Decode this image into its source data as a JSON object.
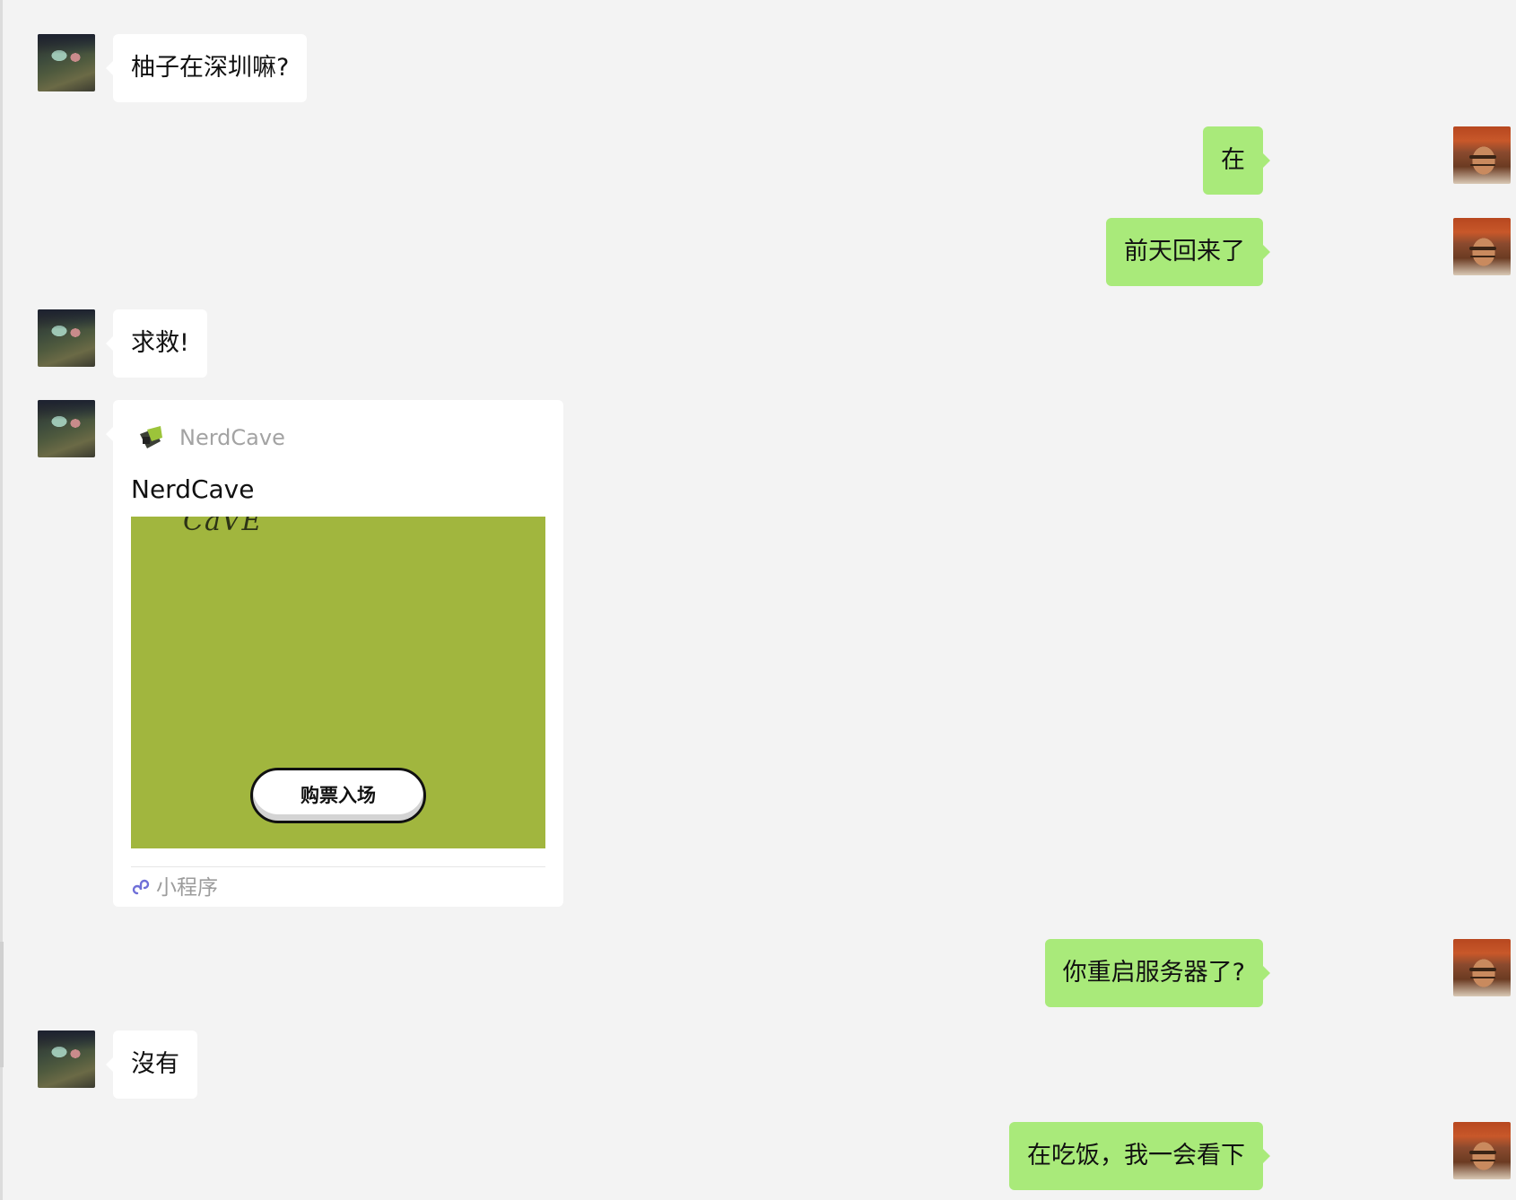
{
  "colors": {
    "background": "#f3f3f3",
    "incoming_bubble": "#ffffff",
    "outgoing_bubble": "#a9ea7a",
    "card_image": "#a1b63e"
  },
  "avatars": {
    "friend": "friend-avatar-photo",
    "me": "my-avatar-portrait"
  },
  "messages": [
    {
      "direction": "in",
      "text": "柚子在深圳嘛?"
    },
    {
      "direction": "out",
      "text": "在"
    },
    {
      "direction": "out",
      "text": "前天回来了"
    },
    {
      "direction": "in",
      "text": "求救!"
    },
    {
      "direction": "in",
      "type": "mini-program-card",
      "source_name": "NerdCave",
      "title": "NerdCave",
      "image_text": "CaVE",
      "button_label": "购票入场",
      "footer_label": "小程序"
    },
    {
      "direction": "out",
      "text": "你重启服务器了?"
    },
    {
      "direction": "in",
      "text": "沒有"
    },
    {
      "direction": "out",
      "text": "在吃饭，我一会看下"
    }
  ]
}
